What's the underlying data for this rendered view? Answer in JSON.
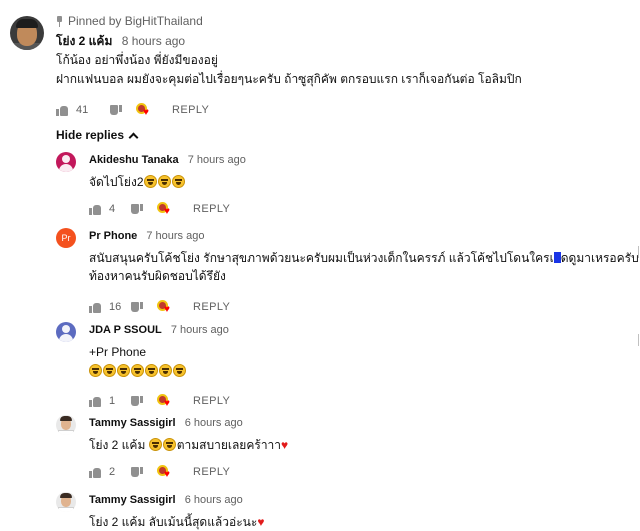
{
  "pinned_comment": {
    "pinned_label": "Pinned by BigHitThailand",
    "author": "โย่ง 2 แค้ม",
    "time": "8 hours ago",
    "text_line1": "โก้น้อง อย่าพึ่งน้อง พี่ยังมีของอยู่",
    "text_line2": "ฝากแฟนบอล ผมยังจะคุมต่อไปเรื่อยๆนะครับ ถ้าซูสุกิคัพ ตกรอบแรก เราก็เจอกันต่อ โอลิมปิก",
    "likes": "41",
    "reply_label": "REPLY"
  },
  "hide_replies_label": "Hide replies",
  "replies": [
    {
      "author": "Akideshu Tanaka",
      "time": "7 hours ago",
      "text": "จัดไปโย่ง2",
      "emoji_count": 3,
      "likes": "4",
      "reply_label": "REPLY",
      "avatar_color": "#c2185b"
    },
    {
      "author": "Pr Phone",
      "time": "7 hours ago",
      "avatar_text": "Pr",
      "text_line1_a": "สนับสนุนครับโค้ชโย่ง รักษาสุขภาพด้วยนะครับผมเป็นห่วงเด็กในครรภ์ แล้วโค้ชไปโดนใครเ",
      "text_line1_b": "ดดูมาเหรอครับ ถึงได้",
      "text_line2": "ท้องหาคนรับผิดชอบได้รึยัง",
      "likes": "16",
      "reply_label": "REPLY",
      "avatar_color": "#f4511e"
    },
    {
      "author": "JDA P SSOUL",
      "time": "7 hours ago",
      "text_line1": "+Pr Phone",
      "emoji_count": 7,
      "likes": "1",
      "reply_label": "REPLY",
      "avatar_color": "#5c6bc0"
    },
    {
      "author": "Tammy Sassigirl",
      "time": "6 hours ago",
      "text_a": "โย่ง 2 แค้ม",
      "text_b": "ตามสบายเลยคร้าาา",
      "likes": "2",
      "reply_label": "REPLY"
    },
    {
      "author": "Tammy Sassigirl",
      "time": "6 hours ago",
      "text": "โย่ง 2 แค้ม ลับเม้นนี้สุดแล้วอ่ะนะ"
    }
  ],
  "icons": {
    "pin": "pin-icon",
    "like": "thumb-up-icon",
    "dislike": "thumb-down-icon",
    "creator_heart": "creator-heart-icon",
    "chevron": "chevron-up-icon",
    "emoji": "laughing-emoji-icon",
    "heart_emoji": "red-heart-icon"
  }
}
